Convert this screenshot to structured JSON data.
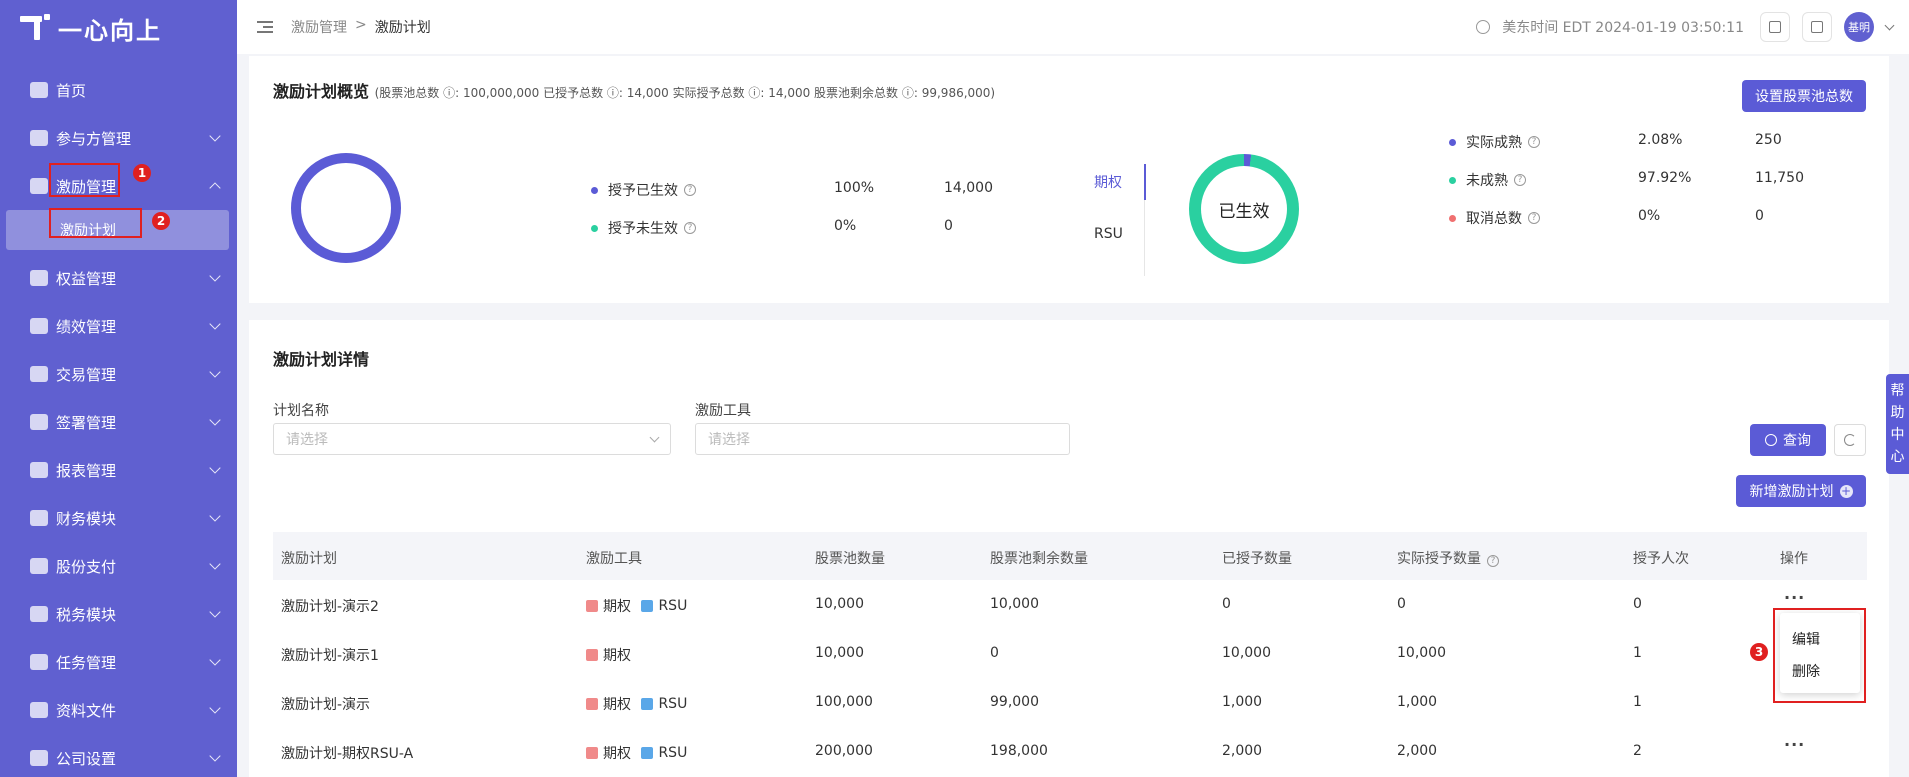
{
  "brand": {
    "name": "一心向上"
  },
  "sidebar": {
    "items": [
      {
        "label": "首页",
        "icon": "home-icon",
        "expandable": false
      },
      {
        "label": "参与方管理",
        "icon": "participant-icon",
        "expandable": true
      },
      {
        "label": "激励管理",
        "icon": "incentive-icon",
        "expandable": true,
        "expanded": true
      },
      {
        "label": "权益管理",
        "icon": "equity-icon",
        "expandable": true
      },
      {
        "label": "绩效管理",
        "icon": "performance-icon",
        "expandable": true
      },
      {
        "label": "交易管理",
        "icon": "trade-icon",
        "expandable": true
      },
      {
        "label": "签署管理",
        "icon": "sign-icon",
        "expandable": true
      },
      {
        "label": "报表管理",
        "icon": "report-icon",
        "expandable": true
      },
      {
        "label": "财务模块",
        "icon": "finance-icon",
        "expandable": true
      },
      {
        "label": "股份支付",
        "icon": "share-payment-icon",
        "expandable": true
      },
      {
        "label": "税务模块",
        "icon": "tax-icon",
        "expandable": true
      },
      {
        "label": "任务管理",
        "icon": "task-icon",
        "expandable": true
      },
      {
        "label": "资料文件",
        "icon": "file-icon",
        "expandable": true
      },
      {
        "label": "公司设置",
        "icon": "company-settings-icon",
        "expandable": true
      }
    ],
    "sub_item": {
      "label": "激励计划"
    }
  },
  "annotations": {
    "n1": "1",
    "n2": "2",
    "n3": "3"
  },
  "header": {
    "breadcrumb": [
      "激励管理",
      ">",
      "激励计划"
    ],
    "time": "美东时间 EDT 2024-01-19 03:50:11",
    "avatar": "基明"
  },
  "overview": {
    "title": "激励计划概览",
    "subtitle": "(股票池总数 ⓘ: 100,000,000   已授予总数 ⓘ: 14,000   实际授予总数 ⓘ: 14,000   股票池剩余总数 ⓘ: 99,986,000)",
    "set_pool_button": "设置股票池总数",
    "grant_legend": [
      {
        "label": "授予已生效",
        "pct": "100%",
        "value": "14,000",
        "color": "#5b5bd6"
      },
      {
        "label": "授予未生效",
        "pct": "0%",
        "value": "0",
        "color": "#2ad0a0"
      }
    ],
    "tabs": [
      "期权",
      "RSU"
    ],
    "active_tab": "期权",
    "donut_center": "已生效",
    "vest_legend": [
      {
        "label": "实际成熟",
        "pct": "2.08%",
        "value": "250",
        "color": "#5b5bd6"
      },
      {
        "label": "未成熟",
        "pct": "97.92%",
        "value": "11,750",
        "color": "#2ad0a0"
      },
      {
        "label": "取消总数",
        "pct": "0%",
        "value": "0",
        "color": "#f07070"
      }
    ],
    "vest_fraction": 0.0208
  },
  "details": {
    "title": "激励计划详情",
    "plan_name_label": "计划名称",
    "plan_name_placeholder": "请选择",
    "tool_label": "激励工具",
    "tool_placeholder": "请选择",
    "query_button": "查询",
    "add_button": "新增激励计划",
    "columns": [
      "激励计划",
      "激励工具",
      "股票池数量",
      "股票池剩余数量",
      "已授予数量",
      "实际授予数量",
      "授予人次",
      "操作"
    ],
    "rows": [
      {
        "name": "激励计划-演示2",
        "tools": [
          "期权",
          "RSU"
        ],
        "pool": "10,000",
        "remain": "10,000",
        "granted": "0",
        "actual": "0",
        "times": "0"
      },
      {
        "name": "激励计划-演示1",
        "tools": [
          "期权"
        ],
        "pool": "10,000",
        "remain": "0",
        "granted": "10,000",
        "actual": "10,000",
        "times": "1"
      },
      {
        "name": "激励计划-演示",
        "tools": [
          "期权",
          "RSU"
        ],
        "pool": "100,000",
        "remain": "99,000",
        "granted": "1,000",
        "actual": "1,000",
        "times": "1"
      },
      {
        "name": "激励计划-期权RSU-A",
        "tools": [
          "期权",
          "RSU"
        ],
        "pool": "200,000",
        "remain": "198,000",
        "granted": "2,000",
        "actual": "2,000",
        "times": "2"
      }
    ],
    "more_label": "···",
    "dropdown": [
      "编辑",
      "删除"
    ]
  },
  "help_tab": [
    "帮",
    "助",
    "中",
    "心"
  ],
  "colors": {
    "primary": "#5b5bd6",
    "sidebar": "#6060d0",
    "green": "#2ad0a0",
    "annotation_red": "#e02020"
  }
}
